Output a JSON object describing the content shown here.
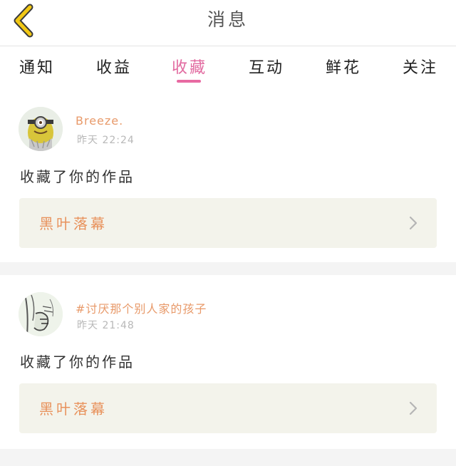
{
  "header": {
    "title": "消息"
  },
  "tabs": [
    {
      "label": "通知",
      "active": false
    },
    {
      "label": "收益",
      "active": false
    },
    {
      "label": "收藏",
      "active": true
    },
    {
      "label": "互动",
      "active": false
    },
    {
      "label": "鲜花",
      "active": false
    },
    {
      "label": "关注",
      "active": false
    }
  ],
  "messages": [
    {
      "user": "Breeze.",
      "time": "昨天 22:24",
      "action": "收藏了你的作品",
      "work": "黑叶落幕",
      "avatar_icon": "minion-avatar-icon"
    },
    {
      "user": "#讨厌那个别人家的孩子",
      "time": "昨天 21:48",
      "action": "收藏了你的作品",
      "work": "黑叶落幕",
      "avatar_icon": "sketch-avatar-icon"
    }
  ],
  "colors": {
    "accent": "#e86aa2",
    "username": "#e89a6a",
    "work_title": "#e8925c",
    "back_icon": "#f2c814"
  }
}
